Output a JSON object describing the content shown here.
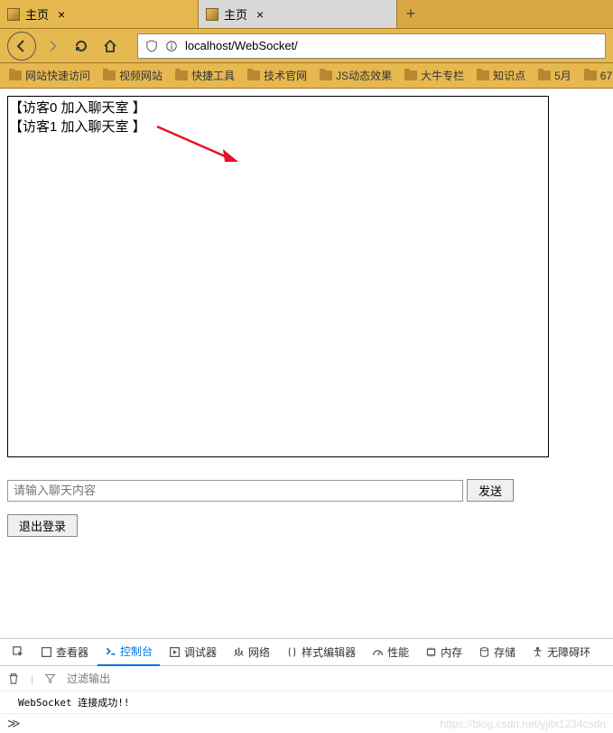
{
  "tabs": [
    {
      "title": "主页",
      "active": true
    },
    {
      "title": "主页",
      "active": false
    }
  ],
  "url": "localhost/WebSocket/",
  "bookmarks": [
    "网站快速访问",
    "视频网站",
    "快捷工具",
    "技术官网",
    "JS动态效果",
    "大牛专栏",
    "知识点",
    "5月",
    "67"
  ],
  "chat": {
    "messages": [
      "【访客0 加入聊天室 】",
      "【访客1 加入聊天室 】"
    ],
    "placeholder": "请输入聊天内容",
    "send_label": "发送",
    "logout_label": "退出登录"
  },
  "devtools": {
    "tabs": [
      "查看器",
      "控制台",
      "调试器",
      "网络",
      "样式编辑器",
      "性能",
      "内存",
      "存储",
      "无障碍环"
    ],
    "active_tab": "控制台",
    "filter_placeholder": "过滤输出",
    "console_message": "WebSocket 连接成功!!"
  },
  "watermark": "https://blog.csdn.net/yjltx1234csdn"
}
